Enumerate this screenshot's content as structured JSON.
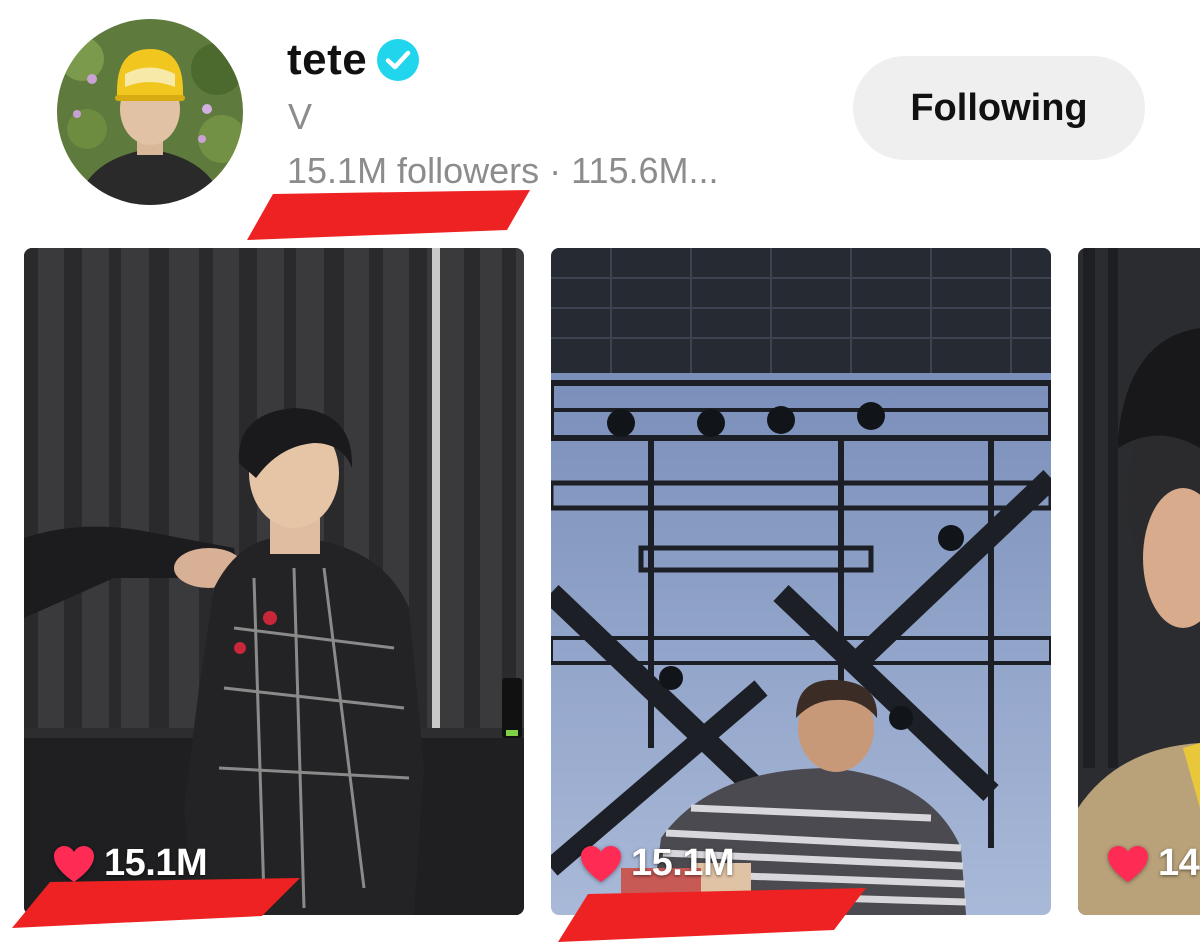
{
  "profile": {
    "username": "tete",
    "display_name": "V",
    "stats": "15.1M followers · 115.6M...",
    "verified_icon": "verified-badge-icon",
    "follow_button_label": "Following"
  },
  "videos": [
    {
      "likes": "15.1M",
      "icon": "heart-icon"
    },
    {
      "likes": "15.1M",
      "icon": "heart-icon"
    },
    {
      "likes": "14",
      "icon": "heart-icon"
    }
  ],
  "colors": {
    "verified": "#20d5ec",
    "heart": "#fe2c55",
    "annotation": "#ee2222",
    "button_bg": "#efefef",
    "secondary_text": "#8c8c8c"
  }
}
